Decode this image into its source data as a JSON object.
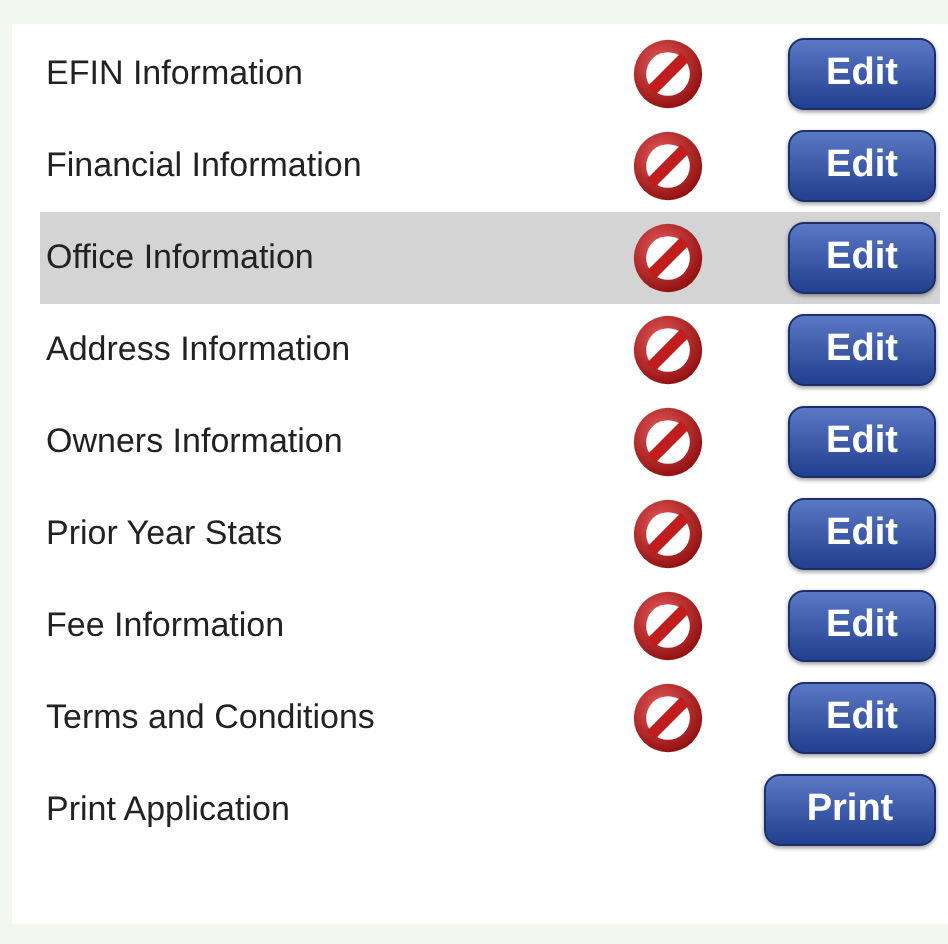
{
  "sections": [
    {
      "kind": "section",
      "label": "EFIN Information",
      "complete": false,
      "selected": false,
      "button": "Edit"
    },
    {
      "kind": "section",
      "label": "Financial Information",
      "complete": false,
      "selected": false,
      "button": "Edit"
    },
    {
      "kind": "section",
      "label": "Office Information",
      "complete": false,
      "selected": true,
      "button": "Edit"
    },
    {
      "kind": "section",
      "label": "Address Information",
      "complete": false,
      "selected": false,
      "button": "Edit"
    },
    {
      "kind": "section",
      "label": "Owners Information",
      "complete": false,
      "selected": false,
      "button": "Edit"
    },
    {
      "kind": "section",
      "label": "Prior Year Stats",
      "complete": false,
      "selected": false,
      "button": "Edit"
    },
    {
      "kind": "section",
      "label": "Fee Information",
      "complete": false,
      "selected": false,
      "button": "Edit"
    },
    {
      "kind": "section",
      "label": "Terms and Conditions",
      "complete": false,
      "selected": false,
      "button": "Edit"
    },
    {
      "kind": "action",
      "label": "Print Application",
      "selected": false,
      "button": "Print"
    }
  ]
}
